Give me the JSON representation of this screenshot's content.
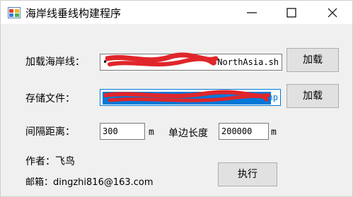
{
  "window": {
    "title": "海岸线垂线构建程序",
    "icon": "app-window-icon",
    "controls": {
      "minimize": "minimize-icon",
      "maximize": "maximize-icon",
      "close": "close-icon"
    }
  },
  "load_coastline": {
    "label": "加载海岸线：",
    "value_visible_end": "NorthAsia.sh",
    "value_prefix_visible": "•",
    "button_label": "加载"
  },
  "save_file": {
    "label": "存储文件：",
    "value_visible_end": "hp",
    "button_label": "加载"
  },
  "interval": {
    "label": "间隔距离：",
    "value": "300",
    "unit": "m"
  },
  "side_length": {
    "label": "单边长度",
    "value": "200000",
    "unit": "m"
  },
  "author": {
    "label": "作者：飞鸟",
    "email": "邮箱：dingzhi816@163.com"
  },
  "execute_button": "执行",
  "colors": {
    "redaction": "#e0262a",
    "selection": "#0078d7",
    "focus_border": "#0078d7"
  }
}
